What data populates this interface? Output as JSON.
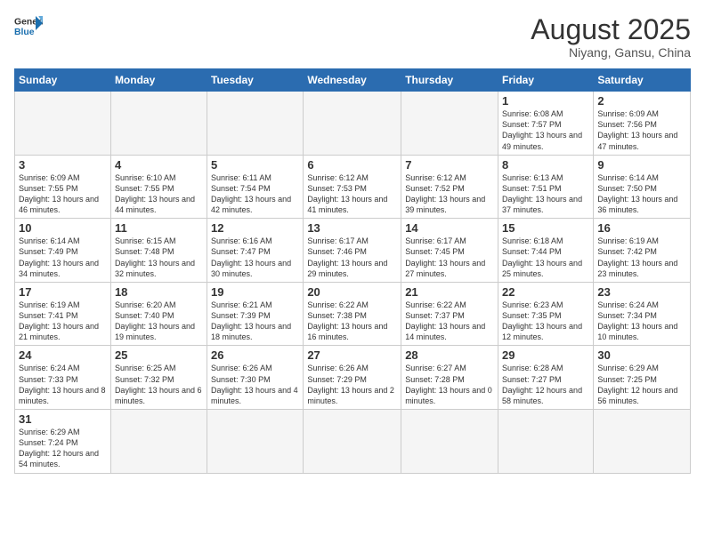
{
  "header": {
    "logo_general": "General",
    "logo_blue": "Blue",
    "month_year": "August 2025",
    "location": "Niyang, Gansu, China"
  },
  "days_of_week": [
    "Sunday",
    "Monday",
    "Tuesday",
    "Wednesday",
    "Thursday",
    "Friday",
    "Saturday"
  ],
  "weeks": [
    [
      {
        "day": "",
        "info": ""
      },
      {
        "day": "",
        "info": ""
      },
      {
        "day": "",
        "info": ""
      },
      {
        "day": "",
        "info": ""
      },
      {
        "day": "",
        "info": ""
      },
      {
        "day": "1",
        "info": "Sunrise: 6:08 AM\nSunset: 7:57 PM\nDaylight: 13 hours and 49 minutes."
      },
      {
        "day": "2",
        "info": "Sunrise: 6:09 AM\nSunset: 7:56 PM\nDaylight: 13 hours and 47 minutes."
      }
    ],
    [
      {
        "day": "3",
        "info": "Sunrise: 6:09 AM\nSunset: 7:55 PM\nDaylight: 13 hours and 46 minutes."
      },
      {
        "day": "4",
        "info": "Sunrise: 6:10 AM\nSunset: 7:55 PM\nDaylight: 13 hours and 44 minutes."
      },
      {
        "day": "5",
        "info": "Sunrise: 6:11 AM\nSunset: 7:54 PM\nDaylight: 13 hours and 42 minutes."
      },
      {
        "day": "6",
        "info": "Sunrise: 6:12 AM\nSunset: 7:53 PM\nDaylight: 13 hours and 41 minutes."
      },
      {
        "day": "7",
        "info": "Sunrise: 6:12 AM\nSunset: 7:52 PM\nDaylight: 13 hours and 39 minutes."
      },
      {
        "day": "8",
        "info": "Sunrise: 6:13 AM\nSunset: 7:51 PM\nDaylight: 13 hours and 37 minutes."
      },
      {
        "day": "9",
        "info": "Sunrise: 6:14 AM\nSunset: 7:50 PM\nDaylight: 13 hours and 36 minutes."
      }
    ],
    [
      {
        "day": "10",
        "info": "Sunrise: 6:14 AM\nSunset: 7:49 PM\nDaylight: 13 hours and 34 minutes."
      },
      {
        "day": "11",
        "info": "Sunrise: 6:15 AM\nSunset: 7:48 PM\nDaylight: 13 hours and 32 minutes."
      },
      {
        "day": "12",
        "info": "Sunrise: 6:16 AM\nSunset: 7:47 PM\nDaylight: 13 hours and 30 minutes."
      },
      {
        "day": "13",
        "info": "Sunrise: 6:17 AM\nSunset: 7:46 PM\nDaylight: 13 hours and 29 minutes."
      },
      {
        "day": "14",
        "info": "Sunrise: 6:17 AM\nSunset: 7:45 PM\nDaylight: 13 hours and 27 minutes."
      },
      {
        "day": "15",
        "info": "Sunrise: 6:18 AM\nSunset: 7:44 PM\nDaylight: 13 hours and 25 minutes."
      },
      {
        "day": "16",
        "info": "Sunrise: 6:19 AM\nSunset: 7:42 PM\nDaylight: 13 hours and 23 minutes."
      }
    ],
    [
      {
        "day": "17",
        "info": "Sunrise: 6:19 AM\nSunset: 7:41 PM\nDaylight: 13 hours and 21 minutes."
      },
      {
        "day": "18",
        "info": "Sunrise: 6:20 AM\nSunset: 7:40 PM\nDaylight: 13 hours and 19 minutes."
      },
      {
        "day": "19",
        "info": "Sunrise: 6:21 AM\nSunset: 7:39 PM\nDaylight: 13 hours and 18 minutes."
      },
      {
        "day": "20",
        "info": "Sunrise: 6:22 AM\nSunset: 7:38 PM\nDaylight: 13 hours and 16 minutes."
      },
      {
        "day": "21",
        "info": "Sunrise: 6:22 AM\nSunset: 7:37 PM\nDaylight: 13 hours and 14 minutes."
      },
      {
        "day": "22",
        "info": "Sunrise: 6:23 AM\nSunset: 7:35 PM\nDaylight: 13 hours and 12 minutes."
      },
      {
        "day": "23",
        "info": "Sunrise: 6:24 AM\nSunset: 7:34 PM\nDaylight: 13 hours and 10 minutes."
      }
    ],
    [
      {
        "day": "24",
        "info": "Sunrise: 6:24 AM\nSunset: 7:33 PM\nDaylight: 13 hours and 8 minutes."
      },
      {
        "day": "25",
        "info": "Sunrise: 6:25 AM\nSunset: 7:32 PM\nDaylight: 13 hours and 6 minutes."
      },
      {
        "day": "26",
        "info": "Sunrise: 6:26 AM\nSunset: 7:30 PM\nDaylight: 13 hours and 4 minutes."
      },
      {
        "day": "27",
        "info": "Sunrise: 6:26 AM\nSunset: 7:29 PM\nDaylight: 13 hours and 2 minutes."
      },
      {
        "day": "28",
        "info": "Sunrise: 6:27 AM\nSunset: 7:28 PM\nDaylight: 13 hours and 0 minutes."
      },
      {
        "day": "29",
        "info": "Sunrise: 6:28 AM\nSunset: 7:27 PM\nDaylight: 12 hours and 58 minutes."
      },
      {
        "day": "30",
        "info": "Sunrise: 6:29 AM\nSunset: 7:25 PM\nDaylight: 12 hours and 56 minutes."
      }
    ],
    [
      {
        "day": "31",
        "info": "Sunrise: 6:29 AM\nSunset: 7:24 PM\nDaylight: 12 hours and 54 minutes."
      },
      {
        "day": "",
        "info": ""
      },
      {
        "day": "",
        "info": ""
      },
      {
        "day": "",
        "info": ""
      },
      {
        "day": "",
        "info": ""
      },
      {
        "day": "",
        "info": ""
      },
      {
        "day": "",
        "info": ""
      }
    ]
  ]
}
